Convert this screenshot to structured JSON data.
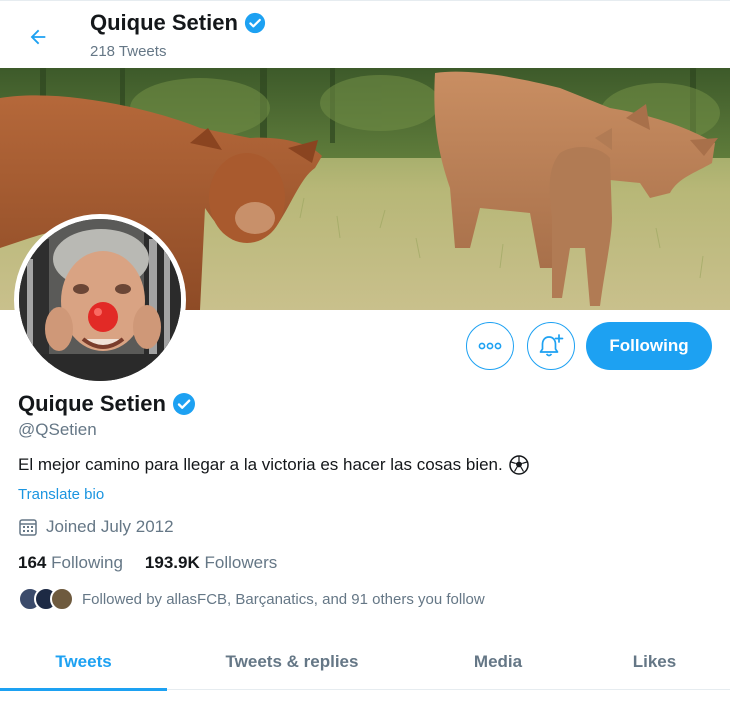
{
  "header": {
    "title": "Quique Setien",
    "tweet_count": "218 Tweets"
  },
  "profile": {
    "name": "Quique Setien",
    "handle": "@QSetien",
    "bio": "El mejor camino para llegar a la victoria es hacer las cosas bien.",
    "bio_emoji": "soccer-ball",
    "translate_label": "Translate bio",
    "joined": "Joined July 2012",
    "following_count": "164",
    "following_label": "Following",
    "followers_count": "193.9K",
    "followers_label": "Followers",
    "followed_by": "Followed by allasFCB, Barçanatics, and 91 others you follow",
    "verified": true
  },
  "actions": {
    "more_icon": "more-dots-icon",
    "notify_icon": "bell-plus-icon",
    "follow_label": "Following"
  },
  "tabs": [
    {
      "label": "Tweets",
      "active": true
    },
    {
      "label": "Tweets & replies",
      "active": false
    },
    {
      "label": "Media",
      "active": false
    },
    {
      "label": "Likes",
      "active": false
    }
  ],
  "colors": {
    "accent": "#1da1f2",
    "link": "#1b95e0",
    "secondary_text": "#657786"
  }
}
